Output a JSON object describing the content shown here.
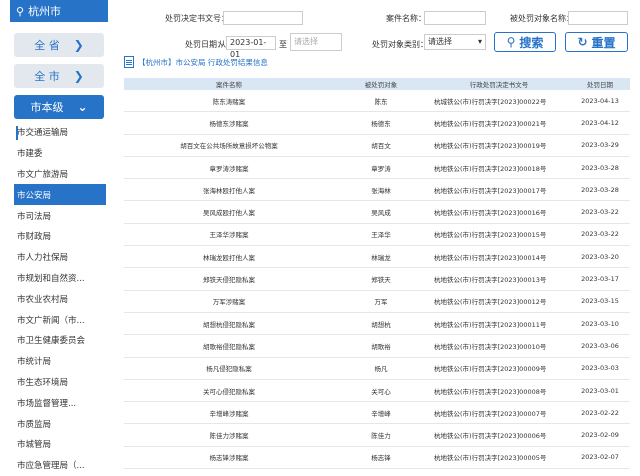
{
  "sidebar": {
    "city": "杭州市",
    "levels": [
      {
        "label": "全 省"
      },
      {
        "label": "全 市"
      },
      {
        "label": "市本级"
      }
    ],
    "departments": [
      "市交通运输局",
      "市建委",
      "市文广旅游局",
      "市公安局",
      "市司法局",
      "市财政局",
      "市人力社保局",
      "市规划和自然资...",
      "市农业农村局",
      "市文广新闻（市...",
      "市卫生健康委员会",
      "市统计局",
      "市生态环境局",
      "市场监督管理...",
      "市质监局",
      "市城管局",
      "市应急管理局（..."
    ]
  },
  "search": {
    "doc_no_label": "处罚决定书文号：",
    "case_name_label": "案件名称：",
    "subject_label": "被处罚对象名称：",
    "date_label": "处罚日期：",
    "from": "从",
    "to": "至",
    "date_from": "2023-01-01",
    "date_to_placeholder": "请选择",
    "type_label": "处罚对象类别：",
    "type_value": "请选择",
    "search_btn": "搜索",
    "reset_btn": "重置"
  },
  "breadcrumb": "【杭州市】市公安局 行政处罚结果信息",
  "table": {
    "headers": [
      "案件名称",
      "被处罚对象",
      "行政处罚决定书文号",
      "处罚日期"
    ],
    "rows": [
      [
        "陈东涛赌案",
        "陈东",
        "杭城铁公(市)行罚决字[2023]00022号",
        "2023-04-13"
      ],
      [
        "杨德东涉赌案",
        "杨德东",
        "杭地铁公(市)行罚决字[2023]00021号",
        "2023-04-12"
      ],
      [
        "胡百文在公共场所故意损坏公物案",
        "胡百文",
        "杭地铁公(市)行罚决字[2023]00019号",
        "2023-03-29"
      ],
      [
        "章罗涛涉赌案",
        "章罗涛",
        "杭地铁公(市)行罚决字[2023]00018号",
        "2023-03-28"
      ],
      [
        "张海林殴打他人案",
        "张海林",
        "杭地铁公(市)行罚决字[2023]00017号",
        "2023-03-28"
      ],
      [
        "吴风成殴打他人案",
        "吴风成",
        "杭地铁公(市)行罚决字[2023]00016号",
        "2023-03-22"
      ],
      [
        "王泽华涉赌案",
        "王泽华",
        "杭地铁公(市)行罚决字[2023]00015号",
        "2023-03-22"
      ],
      [
        "林瑞龙殴打他人案",
        "林瑞龙",
        "杭地铁公(市)行罚决字[2023]00014号",
        "2023-03-20"
      ],
      [
        "郑铁天侵犯隐私案",
        "郑铁天",
        "杭地铁公(市)行罚决字[2023]00013号",
        "2023-03-17"
      ],
      [
        "万军涉赌案",
        "万军",
        "杭地铁公(市)行罚决字[2023]00012号",
        "2023-03-15"
      ],
      [
        "胡想杭侵犯隐私案",
        "胡想杭",
        "杭地铁公(市)行罚决字[2023]00011号",
        "2023-03-10"
      ],
      [
        "胡歌裕侵犯隐私案",
        "胡歌裕",
        "杭地铁公(市)行罚决字[2023]00010号",
        "2023-03-06"
      ],
      [
        "杨凡侵犯隐私案",
        "杨凡",
        "杭地铁公(市)行罚决字[2023]00009号",
        "2023-03-03"
      ],
      [
        "关可心侵犯隐私案",
        "关可心",
        "杭地铁公(市)行罚决字[2023]00008号",
        "2023-03-01"
      ],
      [
        "辛增峰涉赌案",
        "辛增峰",
        "杭地铁公(市)行罚决字[2023]00007号",
        "2023-02-22"
      ],
      [
        "陈佳力涉赌案",
        "陈佳力",
        "杭地铁公(市)行罚决字[2023]00006号",
        "2023-02-09"
      ],
      [
        "杨志锋涉赌案",
        "杨志锋",
        "杭地铁公(市)行罚决字[2023]00005号",
        "2023-02-07"
      ]
    ]
  }
}
